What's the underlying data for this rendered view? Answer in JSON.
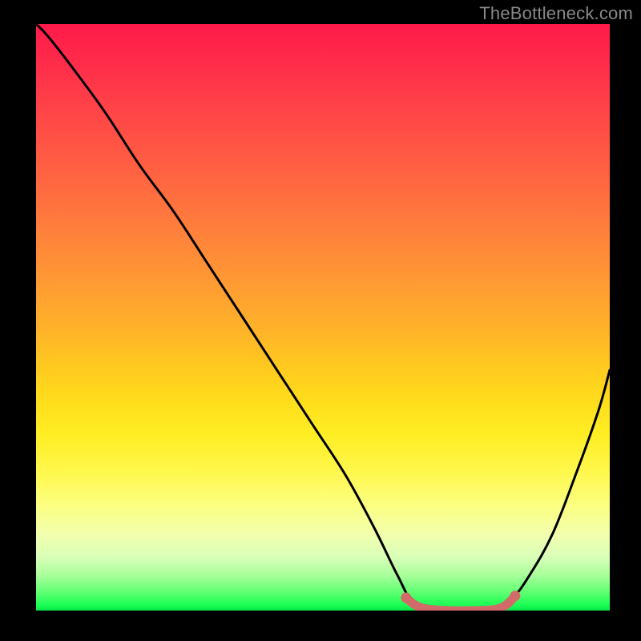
{
  "watermark": "TheBottleneck.com",
  "chart_data": {
    "type": "line",
    "title": "",
    "xlabel": "",
    "ylabel": "",
    "xlim": [
      0,
      1
    ],
    "ylim": [
      0,
      1
    ],
    "note": "Axes are unlabeled in the image. x/y are normalized to the plot rectangle. Lower y (toward 0) corresponds to the green optimal zone; higher y corresponds to red/bottleneck. The black curve reaches its minimum (≈0) between x≈0.66 and x≈0.81.",
    "series": [
      {
        "name": "bottleneck-curve",
        "color": "#000000",
        "x": [
          0.0,
          0.02,
          0.06,
          0.12,
          0.18,
          0.24,
          0.3,
          0.36,
          0.42,
          0.48,
          0.54,
          0.59,
          0.63,
          0.66,
          0.7,
          0.75,
          0.8,
          0.83,
          0.86,
          0.9,
          0.94,
          0.98,
          1.0
        ],
        "y": [
          1.0,
          0.98,
          0.93,
          0.85,
          0.76,
          0.68,
          0.59,
          0.5,
          0.41,
          0.32,
          0.23,
          0.14,
          0.06,
          0.01,
          0.0,
          0.0,
          0.0,
          0.02,
          0.06,
          0.13,
          0.23,
          0.34,
          0.41
        ]
      },
      {
        "name": "optimal-band-marker",
        "color": "#d36a6a",
        "x": [
          0.645,
          0.66,
          0.68,
          0.72,
          0.76,
          0.8,
          0.82,
          0.835
        ],
        "y": [
          0.022,
          0.01,
          0.003,
          0.0,
          0.0,
          0.002,
          0.01,
          0.025
        ]
      }
    ],
    "background_gradient": {
      "direction": "top-to-bottom",
      "stops": [
        {
          "pos": 0.0,
          "color": "#ff1a4a"
        },
        {
          "pos": 0.5,
          "color": "#ffb229"
        },
        {
          "pos": 0.8,
          "color": "#fff74a"
        },
        {
          "pos": 0.95,
          "color": "#5cff70"
        },
        {
          "pos": 1.0,
          "color": "#07e84a"
        }
      ]
    }
  }
}
